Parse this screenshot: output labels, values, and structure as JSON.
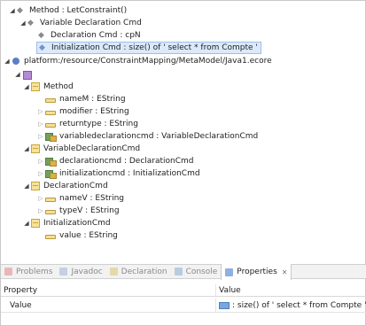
{
  "tree": {
    "items": [
      {
        "label": "Method : LetConstraint()",
        "icon": "method-icon"
      },
      {
        "label": "Variable Declaration Cmd",
        "icon": "method-icon"
      },
      {
        "label": "Declaration Cmd : cpN",
        "icon": "method-icon"
      },
      {
        "label": "Initialization Cmd : size() of  ' select * from Compte '",
        "icon": "method-icon"
      },
      {
        "label": "platform:/resource/ConstraintMapping/MetaModel/Java1.ecore",
        "icon": "resource-icon"
      },
      {
        "label": "",
        "icon": "package-icon"
      },
      {
        "label": "Method",
        "icon": "class-icon"
      },
      {
        "label": "nameM : EString",
        "icon": "attribute-icon"
      },
      {
        "label": "modifier : EString",
        "icon": "attribute-icon"
      },
      {
        "label": "returntype : EString",
        "icon": "attribute-icon"
      },
      {
        "label": "variabledeclarationcmd : VariableDeclarationCmd",
        "icon": "reference-icon"
      },
      {
        "label": "VariableDeclarationCmd",
        "icon": "class-icon"
      },
      {
        "label": "declarationcmd : DeclarationCmd",
        "icon": "reference-icon"
      },
      {
        "label": "initializationcmd : InitializationCmd",
        "icon": "reference-icon"
      },
      {
        "label": "DeclarationCmd",
        "icon": "class-icon"
      },
      {
        "label": "nameV : EString",
        "icon": "attribute-icon"
      },
      {
        "label": "typeV : EString",
        "icon": "attribute-icon"
      },
      {
        "label": "InitializationCmd",
        "icon": "class-icon"
      },
      {
        "label": "value : EString",
        "icon": "attribute-icon"
      }
    ]
  },
  "tabs": [
    {
      "label": "Problems",
      "active": false
    },
    {
      "label": "Javadoc",
      "active": false
    },
    {
      "label": "Declaration",
      "active": false
    },
    {
      "label": "Console",
      "active": false
    },
    {
      "label": "Properties",
      "active": true
    }
  ],
  "properties": {
    "col_property": "Property",
    "col_value": "Value",
    "row_property": "Value",
    "row_value": ": size() of  ' select * from Compte '"
  },
  "colors": {
    "selection": "#dce9fb",
    "class_icon": "#f6e39a"
  }
}
